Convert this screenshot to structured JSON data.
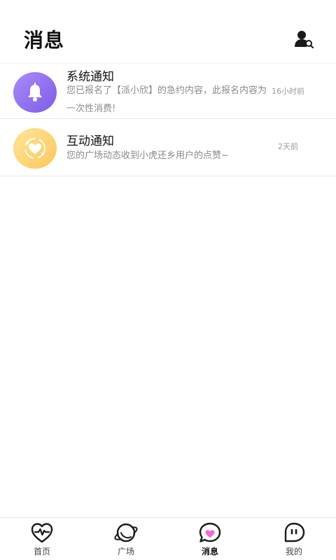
{
  "header": {
    "title": "消息",
    "contact_search_icon": "contact-search-icon"
  },
  "messages": [
    {
      "title": "系统通知",
      "preview": "您已报名了【派小欣】的急约内容，此报名内容为一次性消费!",
      "time": "16小时前",
      "avatar_icon": "bell-icon",
      "avatar_color": "#8b6cf0"
    },
    {
      "title": "互动通知",
      "preview": "您的广场动态收到小虎还乡用户的点赞~",
      "time": "2天前",
      "avatar_icon": "heart-icon",
      "avatar_color": "#fcd06c"
    }
  ],
  "tabbar": {
    "active": "消息",
    "accent": "#f26ad6",
    "items": [
      {
        "label": "首页",
        "icon": "heartbeat-icon"
      },
      {
        "label": "广场",
        "icon": "planet-icon"
      },
      {
        "label": "消息",
        "icon": "message-heart-icon"
      },
      {
        "label": "我的",
        "icon": "face-bubble-icon"
      }
    ]
  }
}
